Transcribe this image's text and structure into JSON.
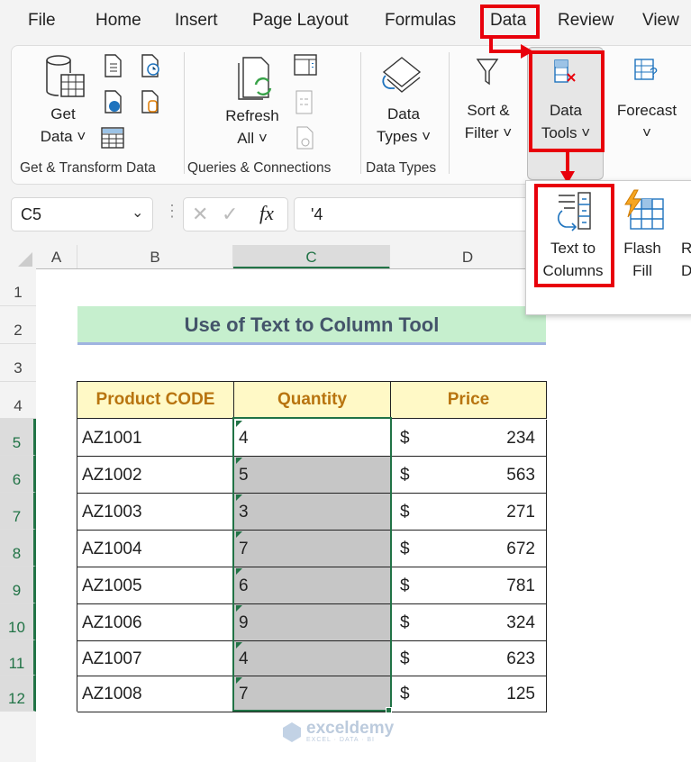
{
  "menu": {
    "tabs": [
      "File",
      "Home",
      "Insert",
      "Page Layout",
      "Formulas",
      "Data",
      "Review",
      "View"
    ],
    "active": "Data"
  },
  "ribbon": {
    "get_data": [
      "Get",
      "Data ˅"
    ],
    "refresh_all": [
      "Refresh",
      "All ˅"
    ],
    "data_types": [
      "Data",
      "Types ˅"
    ],
    "sort_filter": [
      "Sort &",
      "Filter ˅"
    ],
    "data_tools": [
      "Data",
      "Tools ˅"
    ],
    "forecast": [
      "Forecast",
      "˅"
    ],
    "groups": [
      "Get & Transform Data",
      "Queries & Connections",
      "Data Types"
    ]
  },
  "dropdown": {
    "items": [
      [
        "Text to",
        "Columns"
      ],
      [
        "Flash",
        "Fill"
      ],
      [
        "Remove",
        "Duplicates"
      ]
    ]
  },
  "formula_bar": {
    "name_box": "C5",
    "fx": "fx",
    "value": "'4"
  },
  "sheet": {
    "columns": [
      "A",
      "B",
      "C",
      "D"
    ],
    "rows": [
      "1",
      "2",
      "3",
      "4",
      "5",
      "6",
      "7",
      "8",
      "9",
      "10",
      "11",
      "12"
    ],
    "title": "Use of Text to Column Tool",
    "headers": [
      "Product CODE",
      "Quantity",
      "Price"
    ],
    "data": [
      {
        "code": "AZ1001",
        "qty": "4",
        "cur": "$",
        "price": "234"
      },
      {
        "code": "AZ1002",
        "qty": "5",
        "cur": "$",
        "price": "563"
      },
      {
        "code": "AZ1003",
        "qty": "3",
        "cur": "$",
        "price": "271"
      },
      {
        "code": "AZ1004",
        "qty": "7",
        "cur": "$",
        "price": "672"
      },
      {
        "code": "AZ1005",
        "qty": "6",
        "cur": "$",
        "price": "781"
      },
      {
        "code": "AZ1006",
        "qty": "9",
        "cur": "$",
        "price": "324"
      },
      {
        "code": "AZ1007",
        "qty": "4",
        "cur": "$",
        "price": "623"
      },
      {
        "code": "AZ1008",
        "qty": "7",
        "cur": "$",
        "price": "125"
      }
    ]
  },
  "watermark": {
    "name": "exceldemy",
    "tagline": "EXCEL · DATA · BI"
  },
  "colors": {
    "highlight": "#e8000b",
    "excel_green": "#217346",
    "title_fill": "#c6efce",
    "header_fill": "#fff9c6",
    "header_text": "#b8740f",
    "selected_fill": "#c6c6c6"
  }
}
